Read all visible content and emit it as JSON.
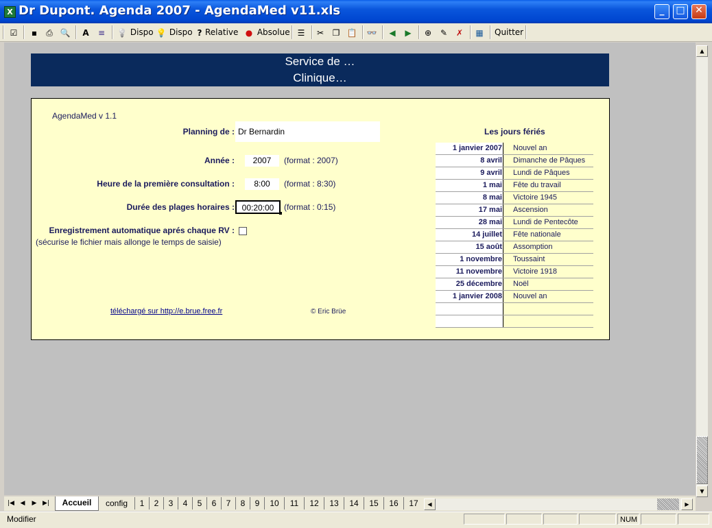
{
  "window": {
    "title": "Dr Dupont. Agenda 2007 - AgendaMed v11.xls",
    "app_icon": "X",
    "minimize": "_",
    "maximize": "□",
    "close": "✕"
  },
  "toolbar": {
    "items": [
      {
        "icon": "checklist-icon",
        "glyph": "☑",
        "label": ""
      },
      {
        "icon": "save-icon",
        "glyph": "▪",
        "label": ""
      },
      {
        "icon": "print-icon",
        "glyph": "⎙",
        "label": ""
      },
      {
        "icon": "print-preview-icon",
        "glyph": "🔍",
        "label": ""
      },
      {
        "icon": "font-icon",
        "glyph": "A",
        "label": ""
      },
      {
        "icon": "format-icon",
        "glyph": "≡",
        "label": ""
      },
      {
        "icon": "bulb-off-icon",
        "glyph": "💡",
        "label": "Dispo"
      },
      {
        "icon": "bulb-on-icon",
        "glyph": "💡",
        "label": "Dispo"
      },
      {
        "icon": "relative-icon",
        "glyph": "?",
        "label": "Relative"
      },
      {
        "icon": "absolute-icon",
        "glyph": "●",
        "label": "Absolue"
      },
      {
        "icon": "list-icon",
        "glyph": "☰",
        "label": ""
      },
      {
        "icon": "cut-icon",
        "glyph": "✂",
        "label": ""
      },
      {
        "icon": "copy-icon",
        "glyph": "❐",
        "label": ""
      },
      {
        "icon": "paste-icon",
        "glyph": "📋",
        "label": ""
      },
      {
        "icon": "find-icon",
        "glyph": "👓",
        "label": ""
      },
      {
        "icon": "arrow-left-icon",
        "glyph": "◀",
        "label": ""
      },
      {
        "icon": "arrow-right-icon",
        "glyph": "▶",
        "label": ""
      },
      {
        "icon": "zoom-icon",
        "glyph": "⊕",
        "label": ""
      },
      {
        "icon": "edit-icon",
        "glyph": "✎",
        "label": ""
      },
      {
        "icon": "delete-icon",
        "glyph": "✗",
        "label": ""
      },
      {
        "icon": "sheet-icon",
        "glyph": "▦",
        "label": ""
      },
      {
        "icon": "quit-icon",
        "glyph": "",
        "label": "Quitter"
      }
    ]
  },
  "banner": {
    "line1": "Service de …",
    "line2": "Clinique…"
  },
  "panel": {
    "version": "AgendaMed v 1.1",
    "planning_label": "Planning de :",
    "planning_value": "Dr Bernardin",
    "year_label": "Année :",
    "year_value": "2007",
    "year_hint": "(format : 2007)",
    "first_label": "Heure de la première consultation :",
    "first_value": "8:00",
    "first_hint": "(format : 8:30)",
    "duration_label": "Durée des plages horaires :",
    "duration_value": "00:20:00",
    "duration_hint": "(format : 0:15)",
    "autosave_label": "Enregistrement automatique aprés chaque RV :",
    "autosave_note": "(sécurise le fichier mais allonge le temps de saisie)",
    "autosave_checked": false,
    "download_link": "téléchargé sur http://e.brue.free.fr",
    "copyright": "© Eric Brüe"
  },
  "holidays": {
    "title": "Les jours fériés",
    "rows": [
      {
        "date": "1 janvier 2007",
        "name": "Nouvel an"
      },
      {
        "date": "8 avril",
        "name": "Dimanche de Pâques"
      },
      {
        "date": "9 avril",
        "name": "Lundi de Pâques"
      },
      {
        "date": "1 mai",
        "name": "Fête du travail"
      },
      {
        "date": "8 mai",
        "name": "Victoire 1945"
      },
      {
        "date": "17 mai",
        "name": "Ascension"
      },
      {
        "date": "28 mai",
        "name": "Lundi de Pentecôte"
      },
      {
        "date": "14 juillet",
        "name": "Fête nationale"
      },
      {
        "date": "15 août",
        "name": "Assomption"
      },
      {
        "date": "1 novembre",
        "name": "Toussaint"
      },
      {
        "date": "11 novembre",
        "name": "Victoire 1918"
      },
      {
        "date": "25 décembre",
        "name": "Noël"
      },
      {
        "date": "1 janvier 2008",
        "name": "Nouvel an"
      },
      {
        "date": "",
        "name": ""
      },
      {
        "date": "",
        "name": ""
      }
    ]
  },
  "tabs": [
    "Accueil",
    "config",
    "1",
    "2",
    "3",
    "4",
    "5",
    "6",
    "7",
    "8",
    "9",
    "10",
    "11",
    "12",
    "13",
    "14",
    "15",
    "16",
    "17"
  ],
  "active_tab": "Accueil",
  "status": {
    "mode": "Modifier",
    "num": "NUM"
  }
}
